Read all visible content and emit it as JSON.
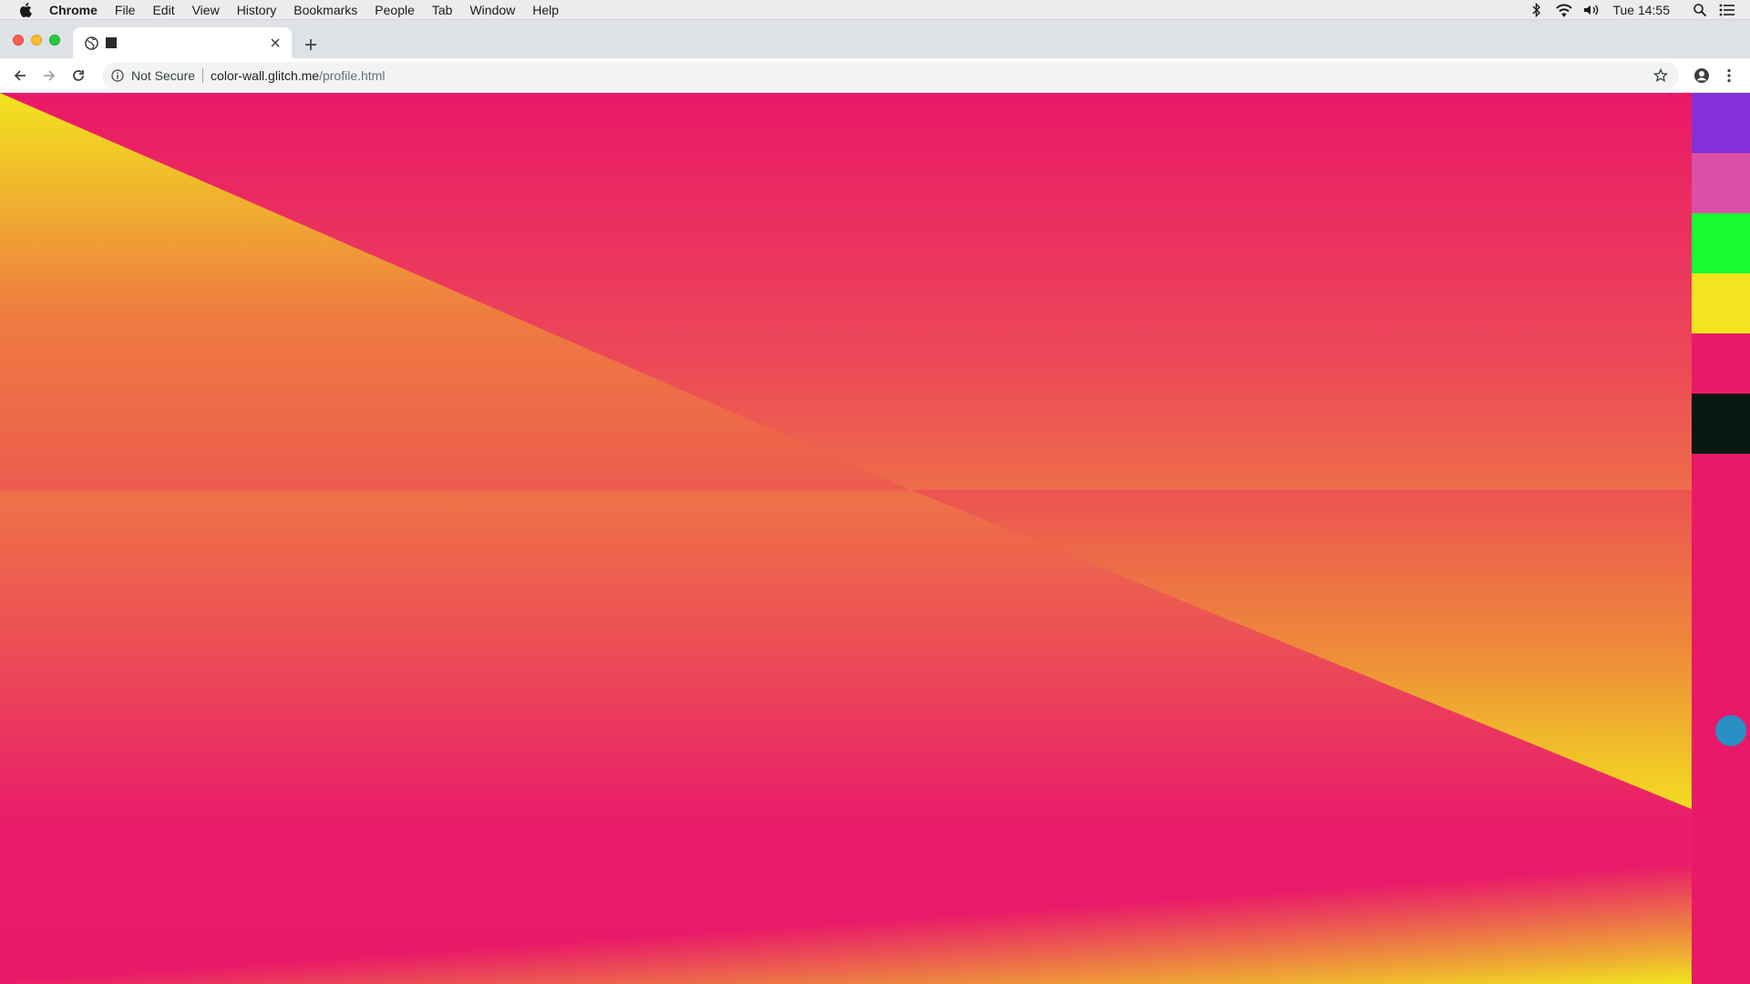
{
  "menubar": {
    "app_name": "Chrome",
    "items": [
      "File",
      "Edit",
      "View",
      "History",
      "Bookmarks",
      "People",
      "Tab",
      "Window",
      "Help"
    ],
    "clock": "Tue 14:55",
    "status_icons": [
      "bluetooth-icon",
      "wifi-icon",
      "volume-icon",
      "spotlight-search-icon",
      "notification-center-icon"
    ]
  },
  "tab": {
    "title": "",
    "favicon": "globe-icon"
  },
  "omnibox": {
    "security_label": "Not Secure",
    "host": "color-wall.glitch.me",
    "path": "/profile.html"
  },
  "page": {
    "colors": {
      "background": "#e91868",
      "triangle_top": "#f2e41e",
      "triangle_bottom": "#ee7048",
      "mid": "#ec4e55"
    },
    "swatches": [
      {
        "name": "purple",
        "color": "#8530d8"
      },
      {
        "name": "pink",
        "color": "#dc4fa8"
      },
      {
        "name": "green",
        "color": "#17fb32"
      },
      {
        "name": "yellow",
        "color": "#f2e41e"
      },
      {
        "name": "magenta",
        "color": "#e91868"
      },
      {
        "name": "black",
        "color": "#051811"
      }
    ],
    "swatch_fill_color": "#e91868",
    "picker_color": "#2a8fc4"
  }
}
